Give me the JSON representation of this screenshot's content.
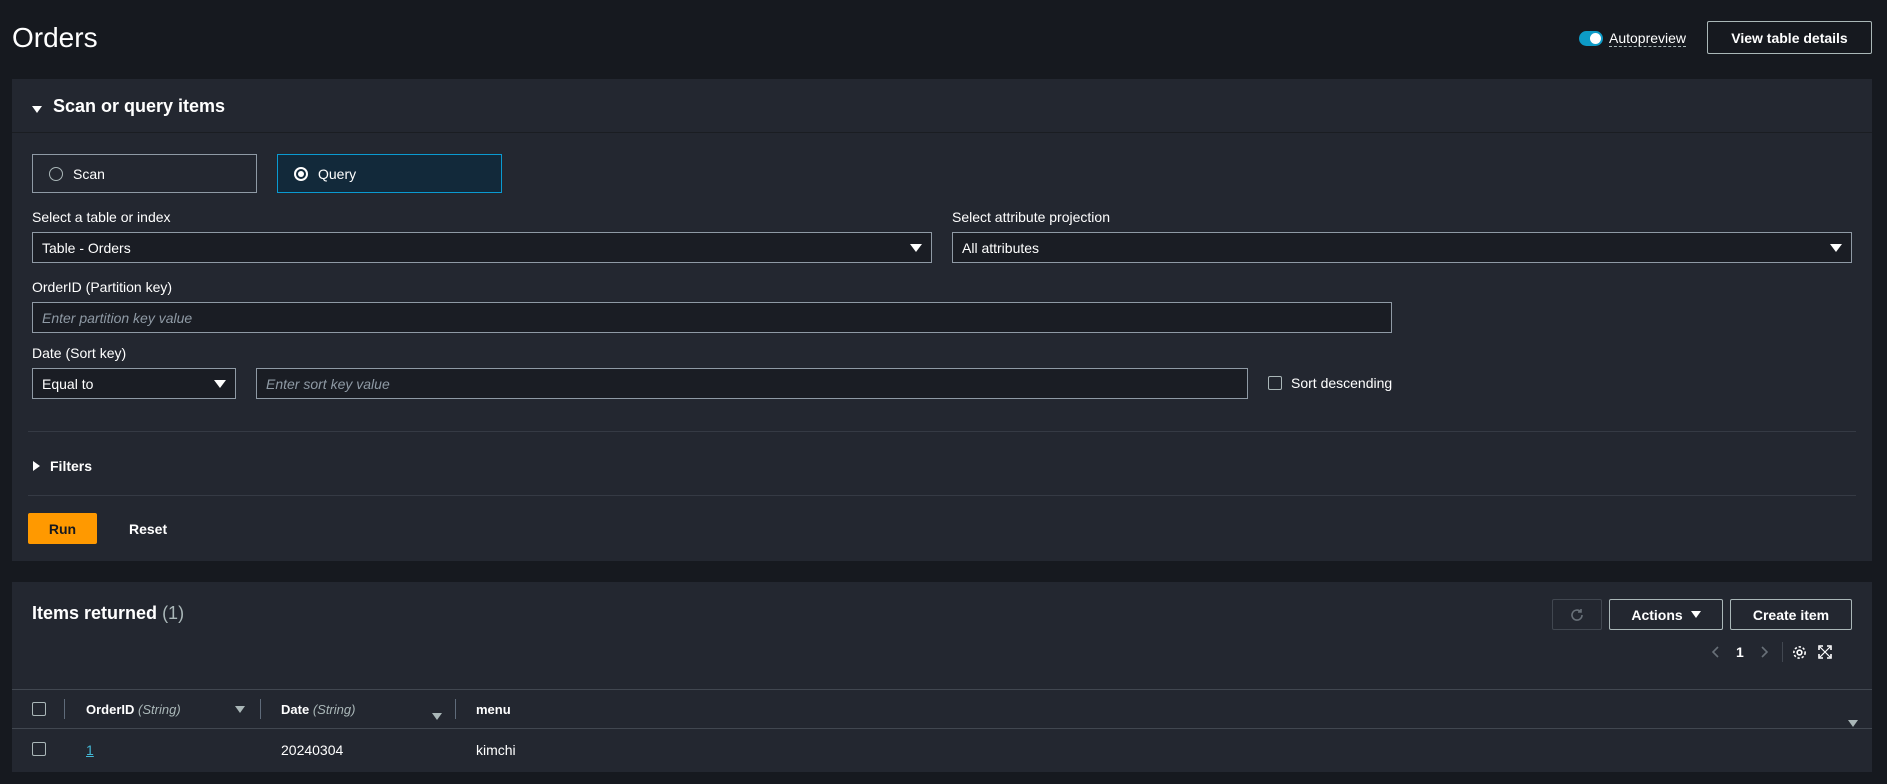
{
  "page": {
    "title": "Orders"
  },
  "header": {
    "autopreview_label": "Autopreview",
    "view_details_label": "View table details"
  },
  "scan_query": {
    "title": "Scan or query items",
    "scan_label": "Scan",
    "query_label": "Query",
    "selected_mode": "Query",
    "table_label": "Select a table or index",
    "table_value": "Table - Orders",
    "projection_label": "Select attribute projection",
    "projection_value": "All attributes",
    "partition_label": "OrderID (Partition key)",
    "partition_placeholder": "Enter partition key value",
    "sort_label": "Date (Sort key)",
    "sort_operator": "Equal to",
    "sort_placeholder": "Enter sort key value",
    "sort_desc_label": "Sort descending",
    "filters_label": "Filters",
    "run_label": "Run",
    "reset_label": "Reset"
  },
  "items": {
    "title": "Items returned",
    "count": "(1)",
    "actions_label": "Actions",
    "create_label": "Create item",
    "page_number": "1",
    "columns": [
      {
        "name": "OrderID",
        "type": "(String)"
      },
      {
        "name": "Date",
        "type": "(String)"
      },
      {
        "name": "menu",
        "type": ""
      }
    ],
    "rows": [
      {
        "order_id": "1",
        "date": "20240304",
        "menu": "kimchi"
      }
    ]
  },
  "colors": {
    "accent": "#ff9900",
    "link": "#44b9d6",
    "selected_border": "#0a9ad1",
    "toggle_on": "#0d9bc7"
  }
}
